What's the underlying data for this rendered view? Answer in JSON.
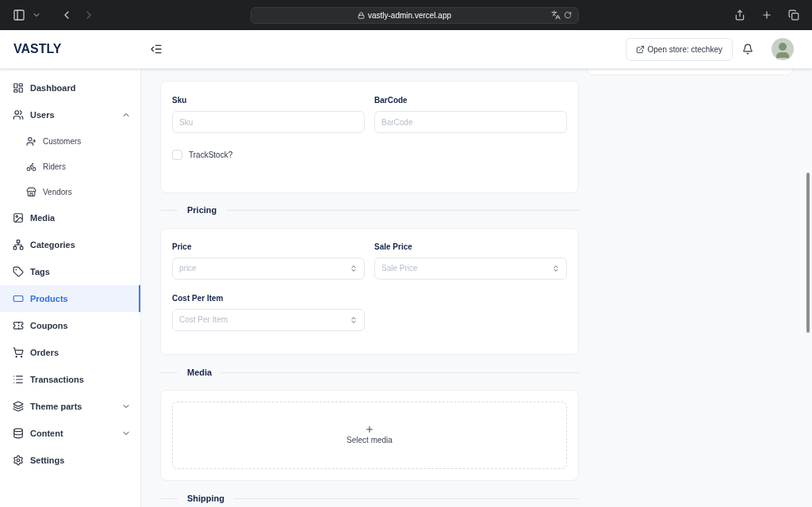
{
  "browser": {
    "url": "vastly-admin.vercel.app"
  },
  "header": {
    "logo": "VASTLY",
    "store_button": "Open store: ctechkey"
  },
  "sidebar": {
    "items": [
      {
        "label": "Dashboard",
        "selected": false
      },
      {
        "label": "Users",
        "selected": false,
        "expanded": true,
        "children": [
          {
            "label": "Customers",
            "selected": false
          },
          {
            "label": "Riders",
            "selected": false
          },
          {
            "label": "Vendors",
            "selected": false
          }
        ]
      },
      {
        "label": "Media",
        "selected": false
      },
      {
        "label": "Categories",
        "selected": false
      },
      {
        "label": "Tags",
        "selected": false
      },
      {
        "label": "Products",
        "selected": true
      },
      {
        "label": "Coupons",
        "selected": false
      },
      {
        "label": "Orders",
        "selected": false
      },
      {
        "label": "Transactions",
        "selected": false
      },
      {
        "label": "Theme parts",
        "selected": false,
        "expanded": false
      },
      {
        "label": "Content",
        "selected": false,
        "expanded": false
      },
      {
        "label": "Settings",
        "selected": false
      }
    ]
  },
  "inventory": {
    "fields": [
      {
        "label": "Sku",
        "placeholder": "Sku",
        "kind": "text"
      },
      {
        "label": "BarCode",
        "placeholder": "BarCode",
        "kind": "text"
      }
    ],
    "checkbox": {
      "label": "TrackStock?",
      "checked": false
    }
  },
  "pricing": {
    "title": "Pricing",
    "fields": [
      {
        "label": "Price",
        "placeholder": "price",
        "kind": "number"
      },
      {
        "label": "Sale Price",
        "placeholder": "Sale Price",
        "kind": "number"
      },
      {
        "label": "Cost Per Item",
        "placeholder": "Cost Per Item",
        "kind": "number"
      }
    ]
  },
  "media": {
    "title": "Media",
    "picker": "Select media"
  },
  "shipping": {
    "title": "Shipping"
  }
}
